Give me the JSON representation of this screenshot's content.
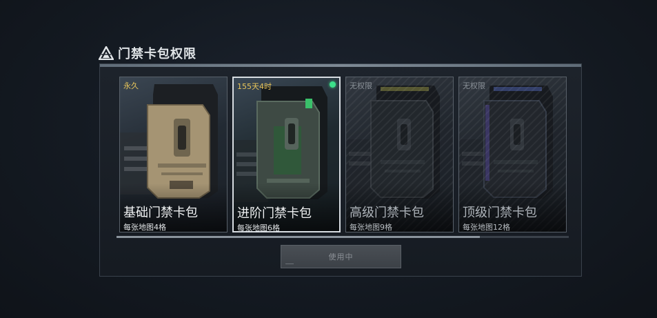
{
  "header": {
    "title": "门禁卡包权限",
    "icon": "triangle-logo-icon"
  },
  "cards": [
    {
      "tag": "永久",
      "name": "基础门禁卡包",
      "desc": "每张地图4格",
      "accent": "#b9a27a"
    },
    {
      "tag": "155天4时",
      "name": "进阶门禁卡包",
      "desc": "每张地图6格",
      "accent": "#4caf6e"
    },
    {
      "tag": "无权限",
      "name": "高级门禁卡包",
      "desc": "每张地图9格",
      "accent": "#8c8a40"
    },
    {
      "tag": "无权限",
      "name": "顶级门禁卡包",
      "desc": "每张地图12格",
      "accent": "#4e5fa6"
    }
  ],
  "selected_card": 2,
  "scroll_position": 0.8,
  "action_button": {
    "label": "使用中"
  },
  "colors": {
    "tag_gold": "#e8c55a",
    "active_dot": "#3ce08a"
  }
}
